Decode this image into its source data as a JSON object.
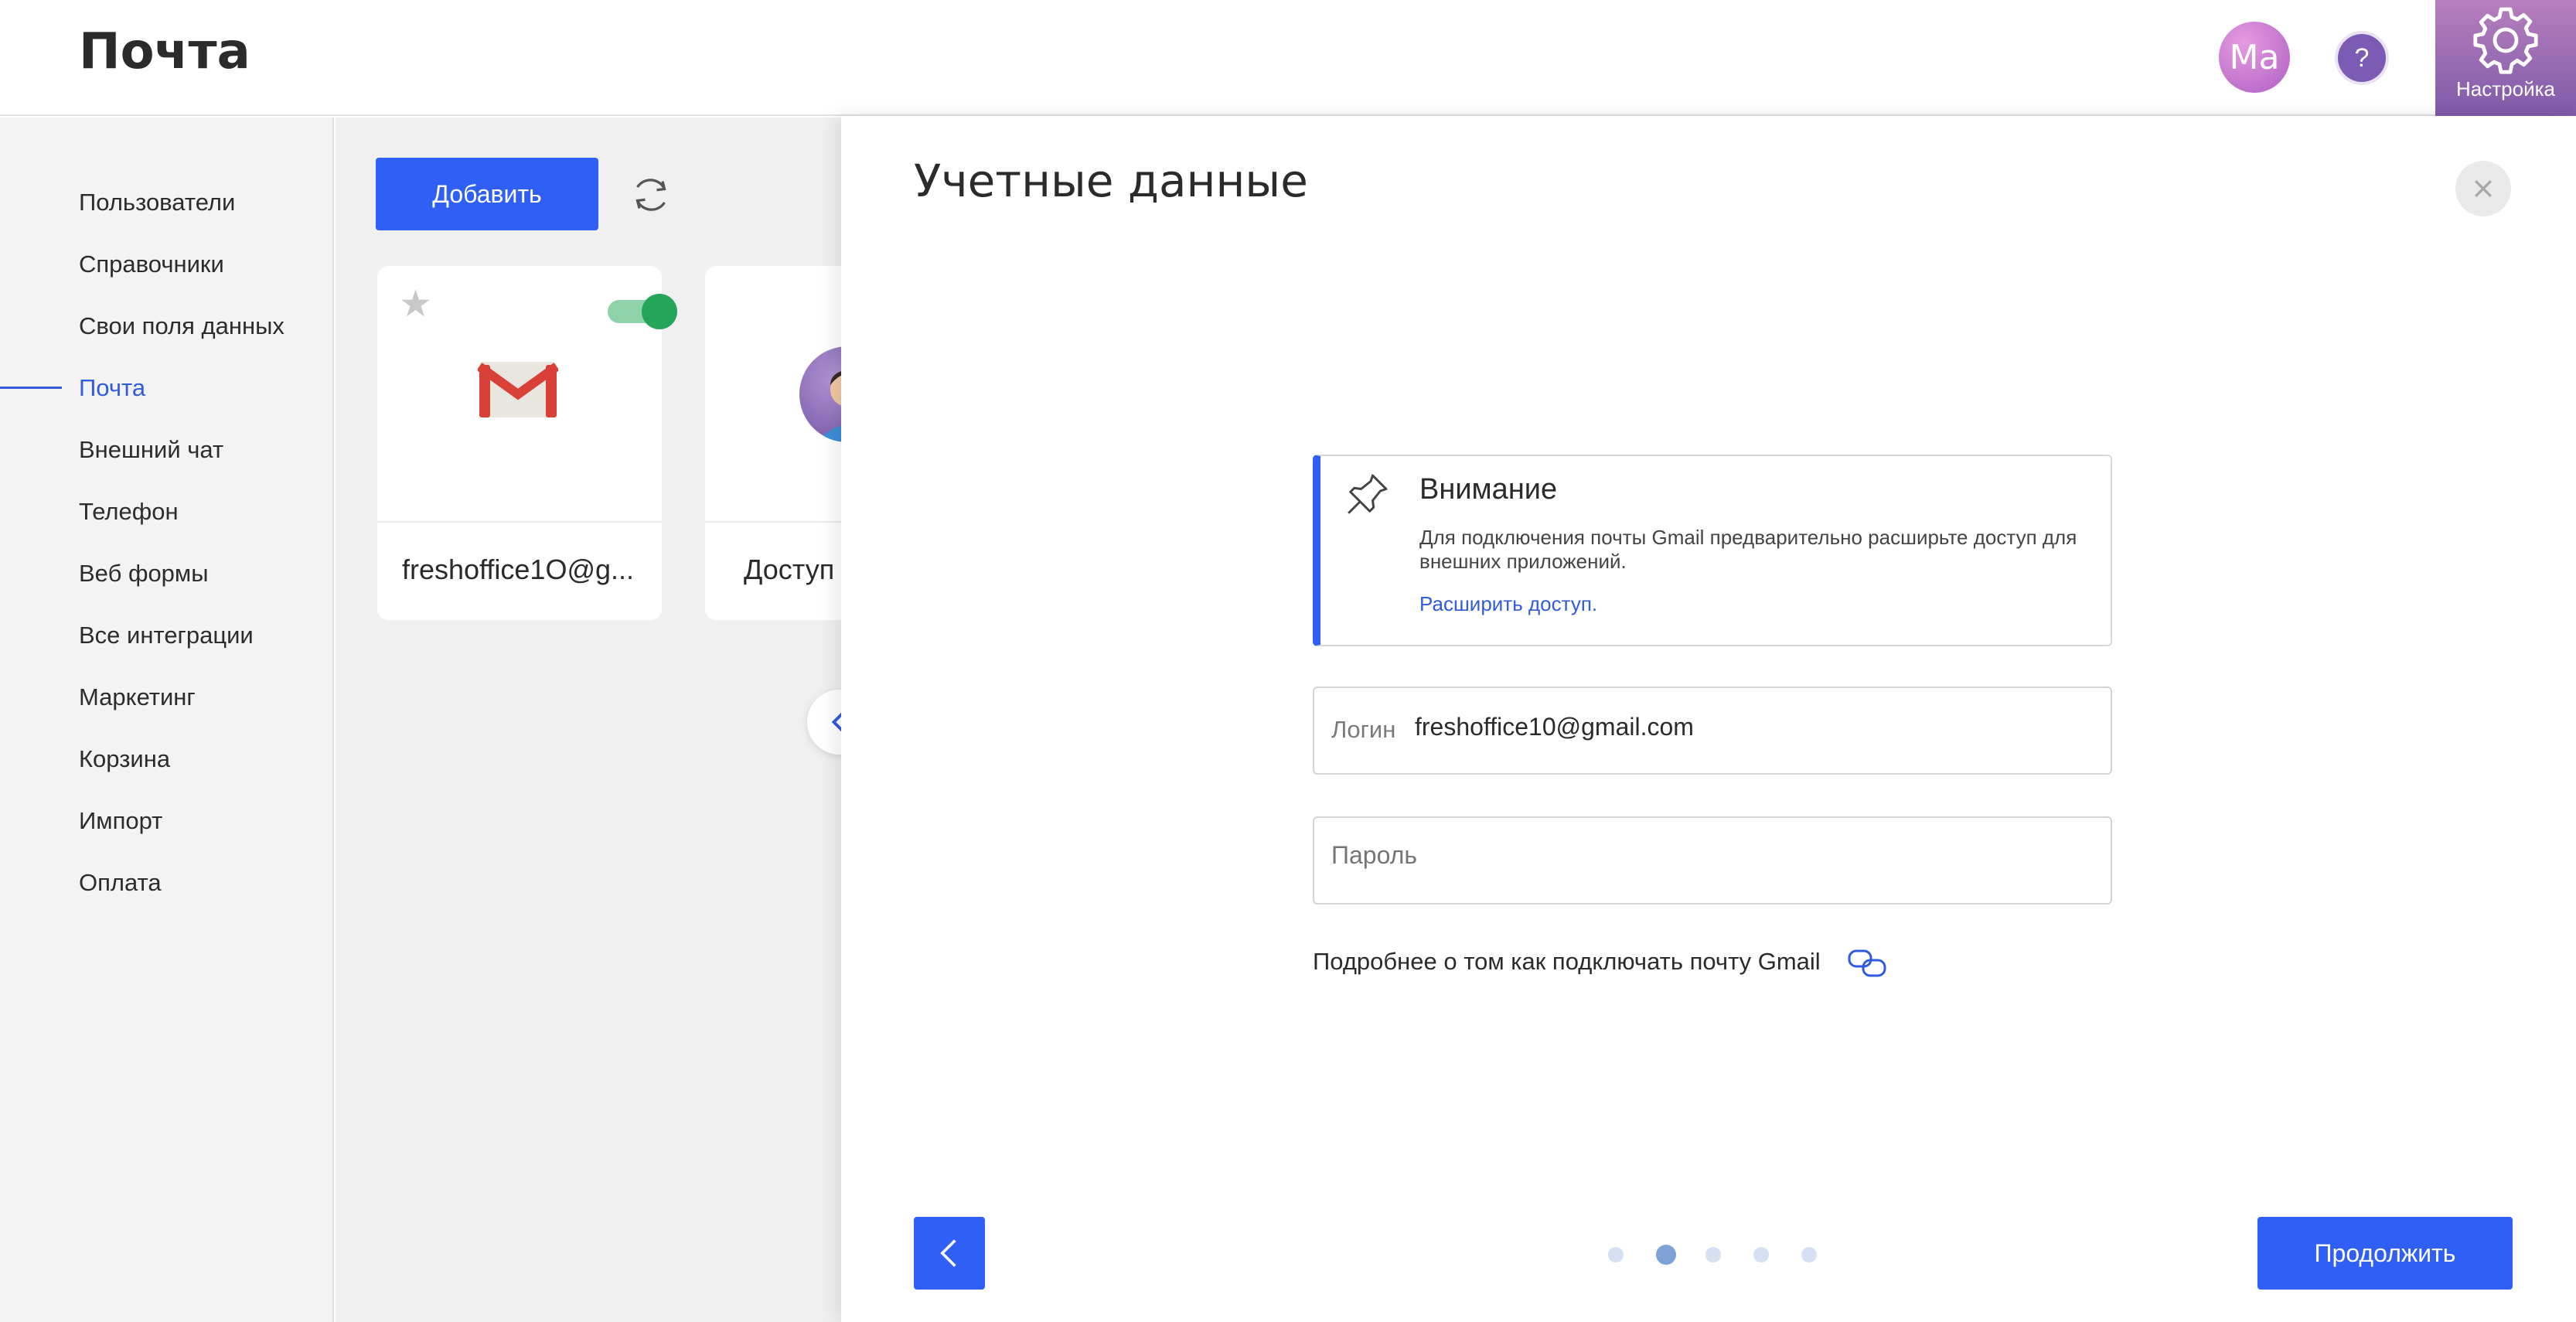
{
  "header": {
    "title": "Почта",
    "avatar_initials": "Ма",
    "help_label": "?",
    "settings_label": "Настройка"
  },
  "sidebar": {
    "items": [
      {
        "label": "Пользователи",
        "active": false
      },
      {
        "label": "Справочники",
        "active": false
      },
      {
        "label": "Свои поля данных",
        "active": false
      },
      {
        "label": "Почта",
        "active": true
      },
      {
        "label": "Внешний чат",
        "active": false
      },
      {
        "label": "Телефон",
        "active": false
      },
      {
        "label": "Веб формы",
        "active": false
      },
      {
        "label": "Все интеграции",
        "active": false
      },
      {
        "label": "Маркетинг",
        "active": false
      },
      {
        "label": "Корзина",
        "active": false
      },
      {
        "label": "Импорт",
        "active": false
      },
      {
        "label": "Оплата",
        "active": false
      }
    ]
  },
  "toolbar": {
    "add_label": "Добавить"
  },
  "cards": [
    {
      "name": "freshoffice1O@g...",
      "icon": "gmail-icon",
      "enabled": true
    },
    {
      "name": "Доступ",
      "icon": "person-avatar-icon"
    }
  ],
  "panel": {
    "title": "Учетные данные",
    "notice": {
      "title": "Внимание",
      "text": "Для подключения почты Gmail предварительно расширьте доступ для внешних приложений.",
      "link": "Расширить доступ."
    },
    "login": {
      "label": "Логин",
      "value": "freshoffice10@gmail.com"
    },
    "password": {
      "placeholder": "Пароль"
    },
    "more_text": "Подробнее о том как подключать почту Gmail",
    "steps": {
      "total": 5,
      "current": 2
    },
    "continue_label": "Продолжить"
  },
  "colors": {
    "accent": "#2f5ff5",
    "active_nav": "#2f5bdc",
    "toggle_on": "#25a55a",
    "settings_bg": "#8f63ad"
  }
}
